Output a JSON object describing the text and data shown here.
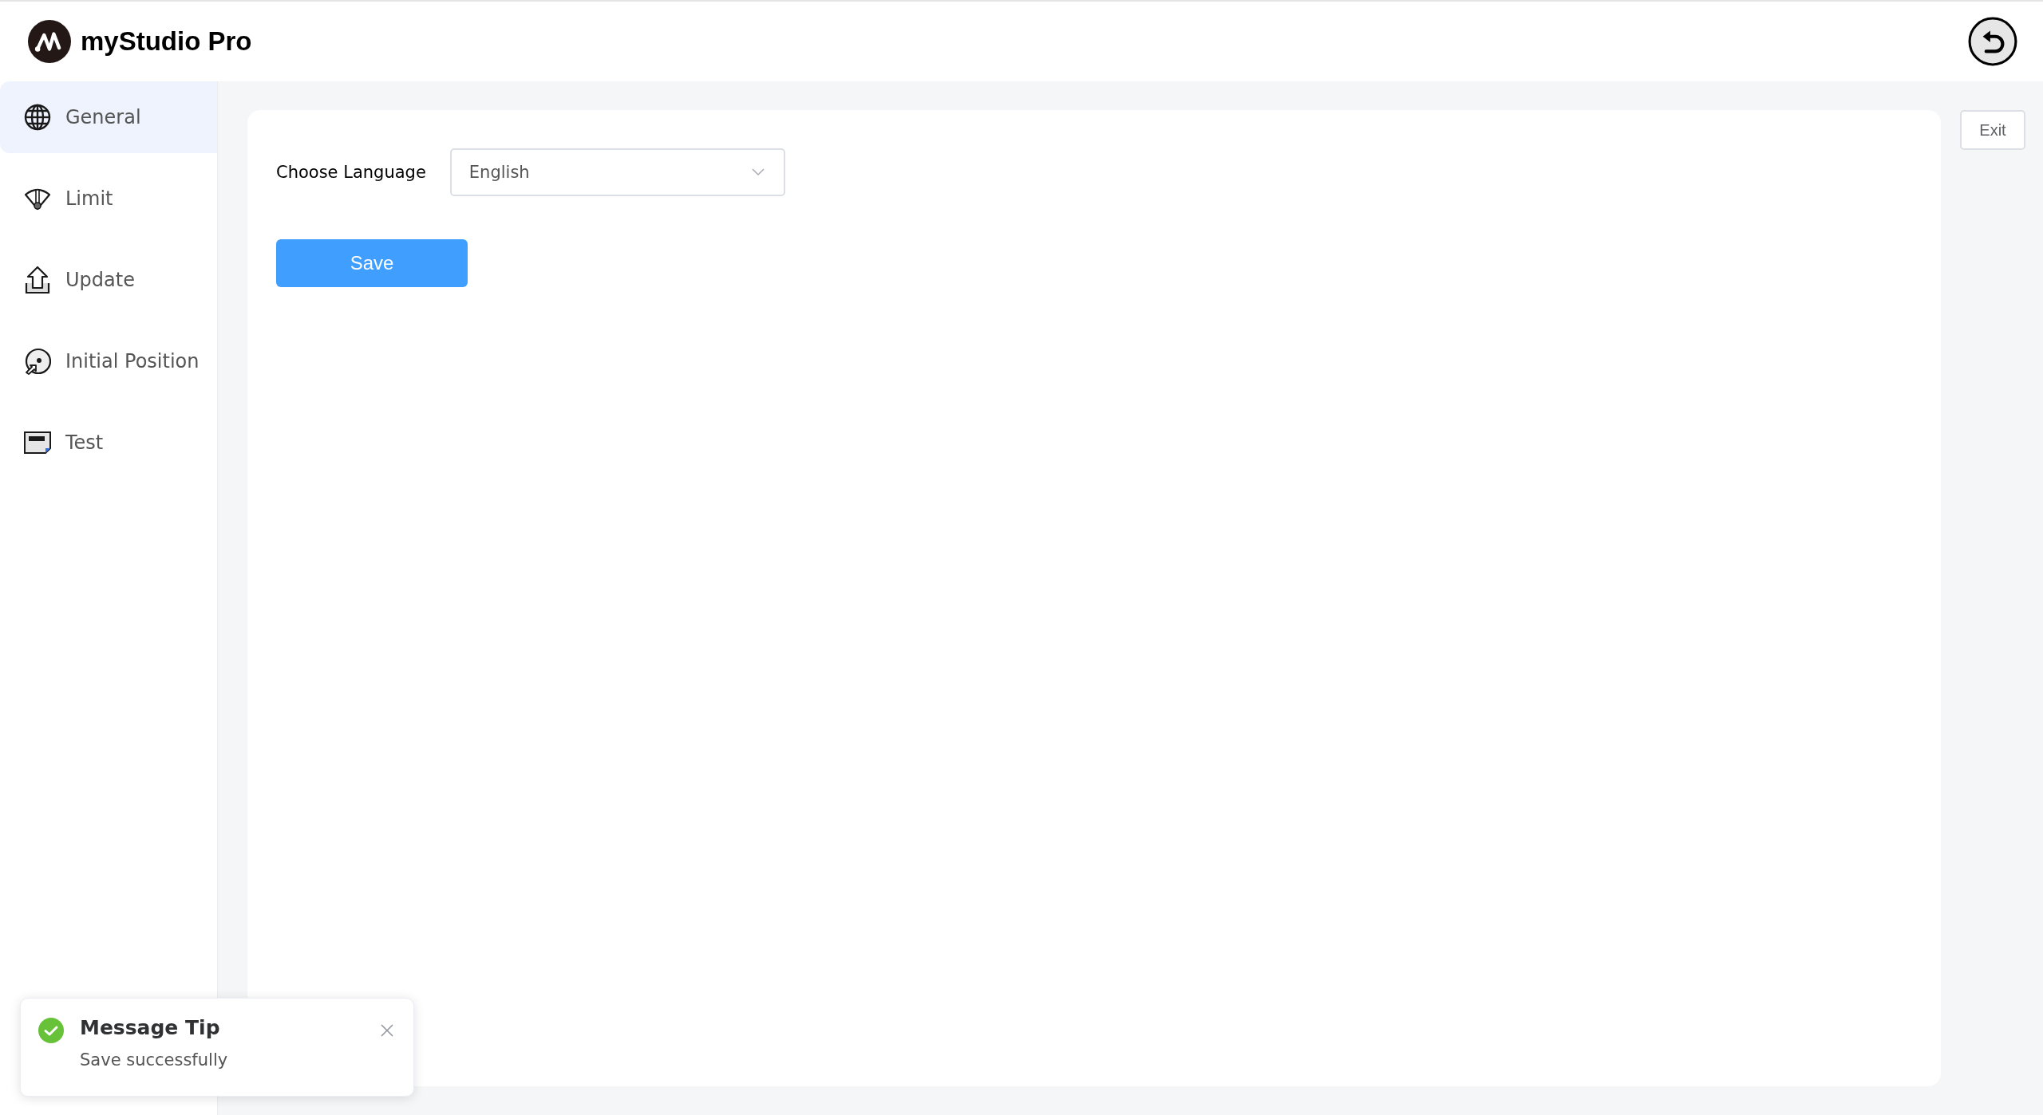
{
  "app": {
    "title": "myStudio Pro"
  },
  "sidebar": {
    "items": [
      {
        "label": "General",
        "selected": true
      },
      {
        "label": "Limit",
        "selected": false
      },
      {
        "label": "Update",
        "selected": false
      },
      {
        "label": "Initial Position",
        "selected": false
      },
      {
        "label": "Test",
        "selected": false
      }
    ]
  },
  "form": {
    "language_label": "Choose Language",
    "language_value": "English",
    "save_button": "Save"
  },
  "exit_button": "Exit",
  "toast": {
    "title": "Message Tip",
    "message": "Save successfully"
  }
}
